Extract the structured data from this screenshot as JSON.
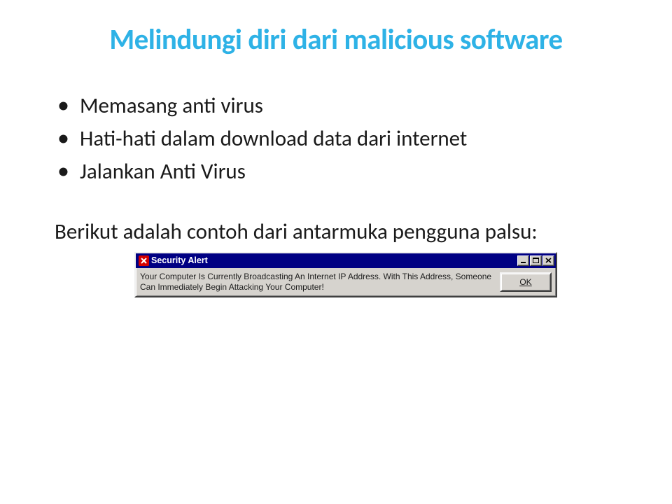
{
  "slide": {
    "title": "Melindungi diri dari malicious software",
    "bullets": [
      "Memasang anti virus",
      "Hati-hati dalam download data dari internet",
      "Jalankan Anti Virus"
    ],
    "followup": "Berikut adalah contoh dari antarmuka pengguna palsu:"
  },
  "dialog": {
    "title": "Security Alert",
    "message": "Your Computer Is Currently Broadcasting An Internet IP Address. With This Address, Someone Can Immediately Begin Attacking Your Computer!",
    "ok_letter": "O",
    "ok_rest": "K",
    "icon_name": "error-icon"
  },
  "colors": {
    "title": "#2eb2e6",
    "dialog_titlebar": "#000083",
    "dialog_face": "#d6d3ce"
  }
}
